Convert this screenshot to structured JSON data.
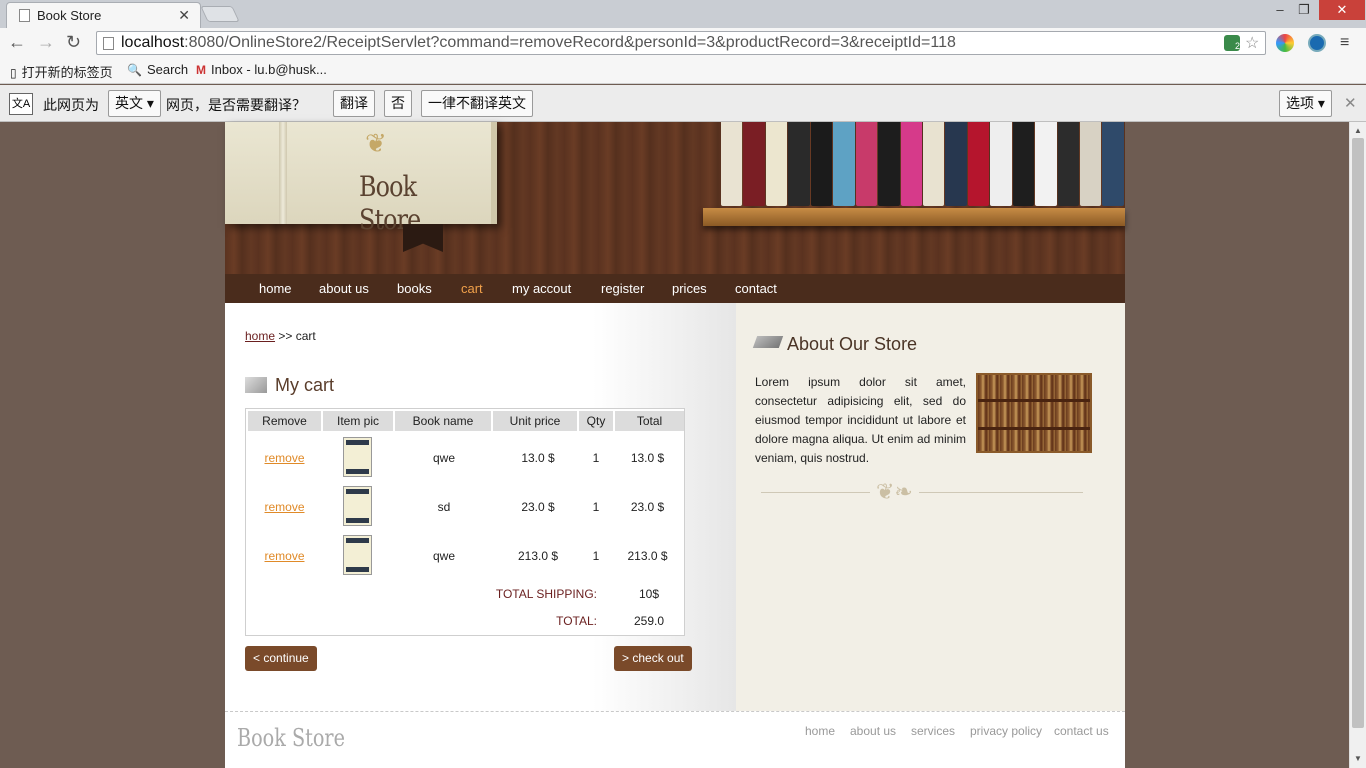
{
  "browser": {
    "tab_title": "Book Store",
    "url_host": "localhost",
    "url_rest": ":8080/OnlineStore2/ReceiptServlet?command=removeRecord&personId=3&productRecord=3&receiptId=118",
    "bookmarks": [
      "打开新的标签页",
      "Search",
      "Inbox - lu.b@husk..."
    ],
    "translate": {
      "prefix": "此网页为",
      "language": "英文",
      "question": "网页，是否需要翻译？",
      "translate_btn": "翻译",
      "no_btn": "否",
      "never_btn": "一律不翻译英文",
      "options_btn": "选项"
    },
    "ext_badge": "2"
  },
  "site": {
    "logo": "Book Store",
    "nav": [
      "home",
      "about us",
      "books",
      "cart",
      "my accout",
      "register",
      "prices",
      "contact"
    ],
    "active_nav": "cart"
  },
  "breadcrumb": {
    "home": "home",
    "sep": " >> ",
    "current": "cart"
  },
  "cart": {
    "title": "My cart",
    "headers": [
      "Remove",
      "Item pic",
      "Book name",
      "Unit price",
      "Qty",
      "Total"
    ],
    "rows": [
      {
        "remove": "remove",
        "name": "qwe",
        "price": "13.0 $",
        "qty": "1",
        "total": "13.0 $"
      },
      {
        "remove": "remove",
        "name": "sd",
        "price": "23.0 $",
        "qty": "1",
        "total": "23.0 $"
      },
      {
        "remove": "remove",
        "name": "qwe",
        "price": "213.0 $",
        "qty": "1",
        "total": "213.0 $"
      }
    ],
    "shipping_label": "TOTAL SHIPPING:",
    "shipping_value": "10$",
    "total_label": "TOTAL:",
    "total_value": "259.0",
    "continue_btn": "< continue",
    "checkout_btn": "> check out"
  },
  "about": {
    "title": "About Our Store",
    "text": "Lorem ipsum dolor sit amet, consectetur adipisicing elit, sed do eiusmod tempor incididunt ut labore et dolore magna aliqua. Ut enim ad minim veniam, quis nostrud."
  },
  "footer": {
    "logo": "Book Store",
    "links": [
      "home",
      "about us",
      "services",
      "privacy policy",
      "contact us"
    ]
  },
  "colors": {
    "accent_orange": "#f0a04a",
    "nav_bg": "#4a2c1c",
    "button_brown": "#7a4a2a",
    "link_red": "#6a1f1f"
  }
}
